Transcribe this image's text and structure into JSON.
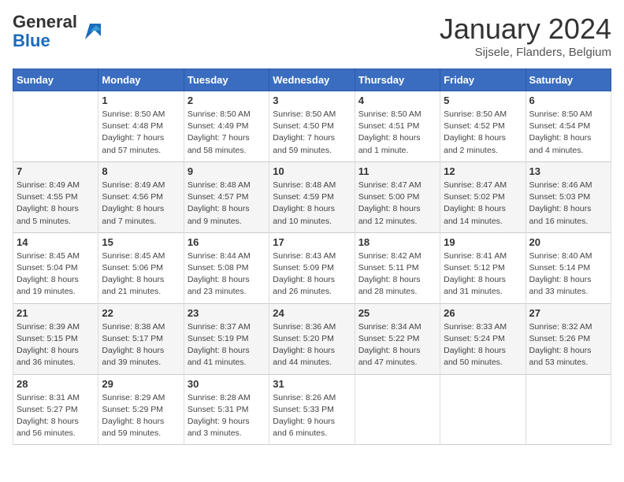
{
  "header": {
    "logo_general": "General",
    "logo_blue": "Blue",
    "month_title": "January 2024",
    "location": "Sijsele, Flanders, Belgium"
  },
  "days_of_week": [
    "Sunday",
    "Monday",
    "Tuesday",
    "Wednesday",
    "Thursday",
    "Friday",
    "Saturday"
  ],
  "weeks": [
    [
      {
        "num": "",
        "lines": []
      },
      {
        "num": "1",
        "lines": [
          "Sunrise: 8:50 AM",
          "Sunset: 4:48 PM",
          "Daylight: 7 hours",
          "and 57 minutes."
        ]
      },
      {
        "num": "2",
        "lines": [
          "Sunrise: 8:50 AM",
          "Sunset: 4:49 PM",
          "Daylight: 7 hours",
          "and 58 minutes."
        ]
      },
      {
        "num": "3",
        "lines": [
          "Sunrise: 8:50 AM",
          "Sunset: 4:50 PM",
          "Daylight: 7 hours",
          "and 59 minutes."
        ]
      },
      {
        "num": "4",
        "lines": [
          "Sunrise: 8:50 AM",
          "Sunset: 4:51 PM",
          "Daylight: 8 hours",
          "and 1 minute."
        ]
      },
      {
        "num": "5",
        "lines": [
          "Sunrise: 8:50 AM",
          "Sunset: 4:52 PM",
          "Daylight: 8 hours",
          "and 2 minutes."
        ]
      },
      {
        "num": "6",
        "lines": [
          "Sunrise: 8:50 AM",
          "Sunset: 4:54 PM",
          "Daylight: 8 hours",
          "and 4 minutes."
        ]
      }
    ],
    [
      {
        "num": "7",
        "lines": [
          "Sunrise: 8:49 AM",
          "Sunset: 4:55 PM",
          "Daylight: 8 hours",
          "and 5 minutes."
        ]
      },
      {
        "num": "8",
        "lines": [
          "Sunrise: 8:49 AM",
          "Sunset: 4:56 PM",
          "Daylight: 8 hours",
          "and 7 minutes."
        ]
      },
      {
        "num": "9",
        "lines": [
          "Sunrise: 8:48 AM",
          "Sunset: 4:57 PM",
          "Daylight: 8 hours",
          "and 9 minutes."
        ]
      },
      {
        "num": "10",
        "lines": [
          "Sunrise: 8:48 AM",
          "Sunset: 4:59 PM",
          "Daylight: 8 hours",
          "and 10 minutes."
        ]
      },
      {
        "num": "11",
        "lines": [
          "Sunrise: 8:47 AM",
          "Sunset: 5:00 PM",
          "Daylight: 8 hours",
          "and 12 minutes."
        ]
      },
      {
        "num": "12",
        "lines": [
          "Sunrise: 8:47 AM",
          "Sunset: 5:02 PM",
          "Daylight: 8 hours",
          "and 14 minutes."
        ]
      },
      {
        "num": "13",
        "lines": [
          "Sunrise: 8:46 AM",
          "Sunset: 5:03 PM",
          "Daylight: 8 hours",
          "and 16 minutes."
        ]
      }
    ],
    [
      {
        "num": "14",
        "lines": [
          "Sunrise: 8:45 AM",
          "Sunset: 5:04 PM",
          "Daylight: 8 hours",
          "and 19 minutes."
        ]
      },
      {
        "num": "15",
        "lines": [
          "Sunrise: 8:45 AM",
          "Sunset: 5:06 PM",
          "Daylight: 8 hours",
          "and 21 minutes."
        ]
      },
      {
        "num": "16",
        "lines": [
          "Sunrise: 8:44 AM",
          "Sunset: 5:08 PM",
          "Daylight: 8 hours",
          "and 23 minutes."
        ]
      },
      {
        "num": "17",
        "lines": [
          "Sunrise: 8:43 AM",
          "Sunset: 5:09 PM",
          "Daylight: 8 hours",
          "and 26 minutes."
        ]
      },
      {
        "num": "18",
        "lines": [
          "Sunrise: 8:42 AM",
          "Sunset: 5:11 PM",
          "Daylight: 8 hours",
          "and 28 minutes."
        ]
      },
      {
        "num": "19",
        "lines": [
          "Sunrise: 8:41 AM",
          "Sunset: 5:12 PM",
          "Daylight: 8 hours",
          "and 31 minutes."
        ]
      },
      {
        "num": "20",
        "lines": [
          "Sunrise: 8:40 AM",
          "Sunset: 5:14 PM",
          "Daylight: 8 hours",
          "and 33 minutes."
        ]
      }
    ],
    [
      {
        "num": "21",
        "lines": [
          "Sunrise: 8:39 AM",
          "Sunset: 5:15 PM",
          "Daylight: 8 hours",
          "and 36 minutes."
        ]
      },
      {
        "num": "22",
        "lines": [
          "Sunrise: 8:38 AM",
          "Sunset: 5:17 PM",
          "Daylight: 8 hours",
          "and 39 minutes."
        ]
      },
      {
        "num": "23",
        "lines": [
          "Sunrise: 8:37 AM",
          "Sunset: 5:19 PM",
          "Daylight: 8 hours",
          "and 41 minutes."
        ]
      },
      {
        "num": "24",
        "lines": [
          "Sunrise: 8:36 AM",
          "Sunset: 5:20 PM",
          "Daylight: 8 hours",
          "and 44 minutes."
        ]
      },
      {
        "num": "25",
        "lines": [
          "Sunrise: 8:34 AM",
          "Sunset: 5:22 PM",
          "Daylight: 8 hours",
          "and 47 minutes."
        ]
      },
      {
        "num": "26",
        "lines": [
          "Sunrise: 8:33 AM",
          "Sunset: 5:24 PM",
          "Daylight: 8 hours",
          "and 50 minutes."
        ]
      },
      {
        "num": "27",
        "lines": [
          "Sunrise: 8:32 AM",
          "Sunset: 5:26 PM",
          "Daylight: 8 hours",
          "and 53 minutes."
        ]
      }
    ],
    [
      {
        "num": "28",
        "lines": [
          "Sunrise: 8:31 AM",
          "Sunset: 5:27 PM",
          "Daylight: 8 hours",
          "and 56 minutes."
        ]
      },
      {
        "num": "29",
        "lines": [
          "Sunrise: 8:29 AM",
          "Sunset: 5:29 PM",
          "Daylight: 8 hours",
          "and 59 minutes."
        ]
      },
      {
        "num": "30",
        "lines": [
          "Sunrise: 8:28 AM",
          "Sunset: 5:31 PM",
          "Daylight: 9 hours",
          "and 3 minutes."
        ]
      },
      {
        "num": "31",
        "lines": [
          "Sunrise: 8:26 AM",
          "Sunset: 5:33 PM",
          "Daylight: 9 hours",
          "and 6 minutes."
        ]
      },
      {
        "num": "",
        "lines": []
      },
      {
        "num": "",
        "lines": []
      },
      {
        "num": "",
        "lines": []
      }
    ]
  ]
}
